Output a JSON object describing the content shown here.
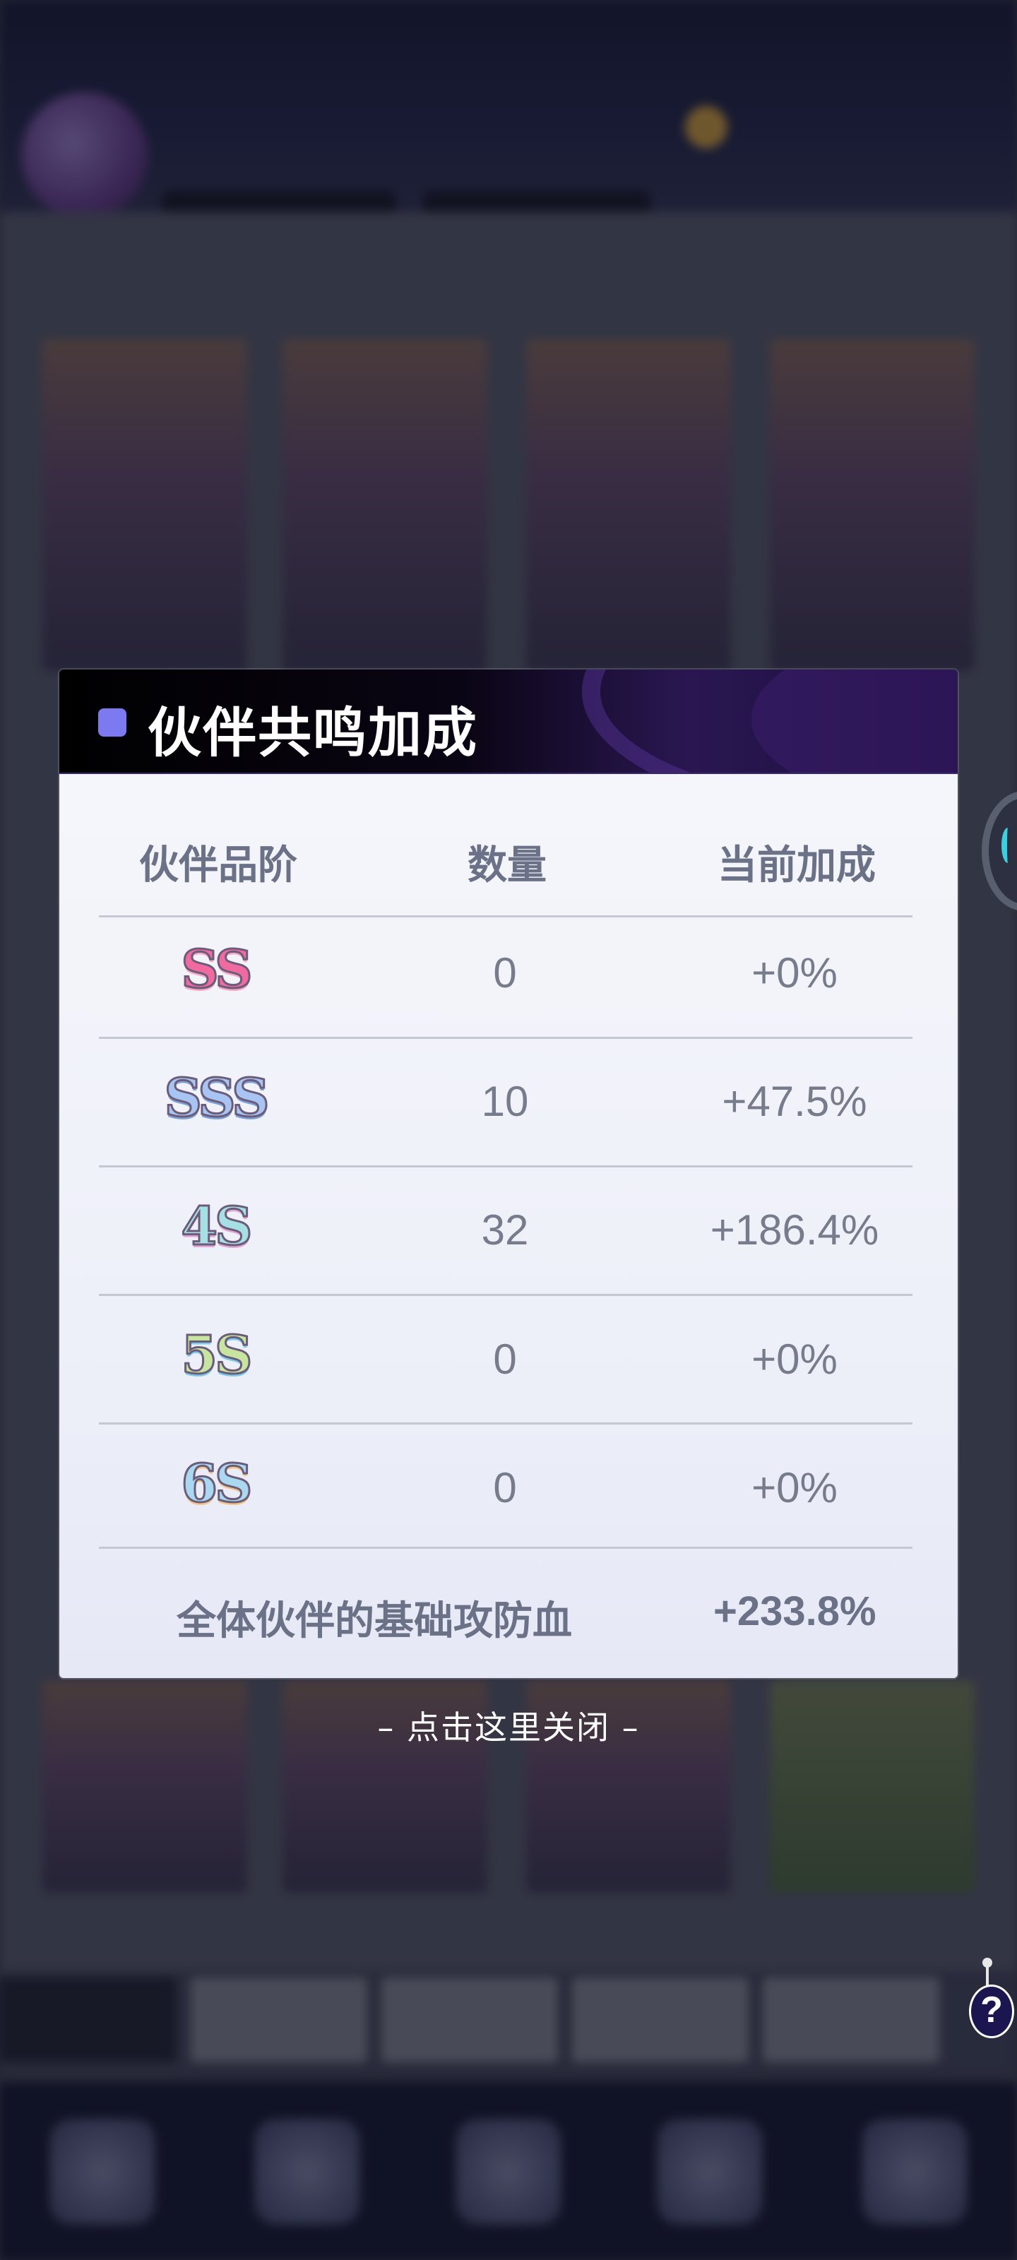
{
  "modal": {
    "title": "伙伴共鸣加成",
    "columns": [
      "伙伴品阶",
      "数量",
      "当前加成"
    ],
    "rows": [
      {
        "rank": "SS",
        "count": "0",
        "bonus": "+0%"
      },
      {
        "rank": "SSS",
        "count": "10",
        "bonus": "+47.5%"
      },
      {
        "rank": "4S",
        "count": "32",
        "bonus": "+186.4%"
      },
      {
        "rank": "5S",
        "count": "0",
        "bonus": "+0%"
      },
      {
        "rank": "6S",
        "count": "0",
        "bonus": "+0%"
      }
    ],
    "total_label": "全体伙伴的基础攻防血",
    "total_value": "+233.8%"
  },
  "close_hint": "– 点击这里关闭 –",
  "help_button": "?",
  "colors": {
    "title_marker": "#7d79f1",
    "header_bg": "#000000",
    "body_bg": "#f2f3fa",
    "text": "#6b7186"
  }
}
